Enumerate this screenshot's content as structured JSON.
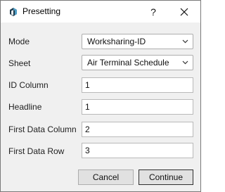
{
  "window": {
    "title": "Presetting",
    "help_label": "?",
    "icons": {
      "app": "app-logo-icon",
      "close": "close-icon"
    }
  },
  "form": {
    "mode": {
      "label": "Mode",
      "value": "Worksharing-ID"
    },
    "sheet": {
      "label": "Sheet",
      "value": "Air Terminal Schedule"
    },
    "id_column": {
      "label": "ID Column",
      "value": "1"
    },
    "headline": {
      "label": "Headline",
      "value": "1"
    },
    "first_data_column": {
      "label": "First Data Column",
      "value": "2"
    },
    "first_data_row": {
      "label": "First Data Row",
      "value": "3"
    }
  },
  "buttons": {
    "cancel": "Cancel",
    "continue": "Continue"
  },
  "colors": {
    "titlebar": "#ffffff",
    "background": "#f0f0f0",
    "icon_dark": "#1f3b4d",
    "icon_light": "#4d9cc4"
  }
}
